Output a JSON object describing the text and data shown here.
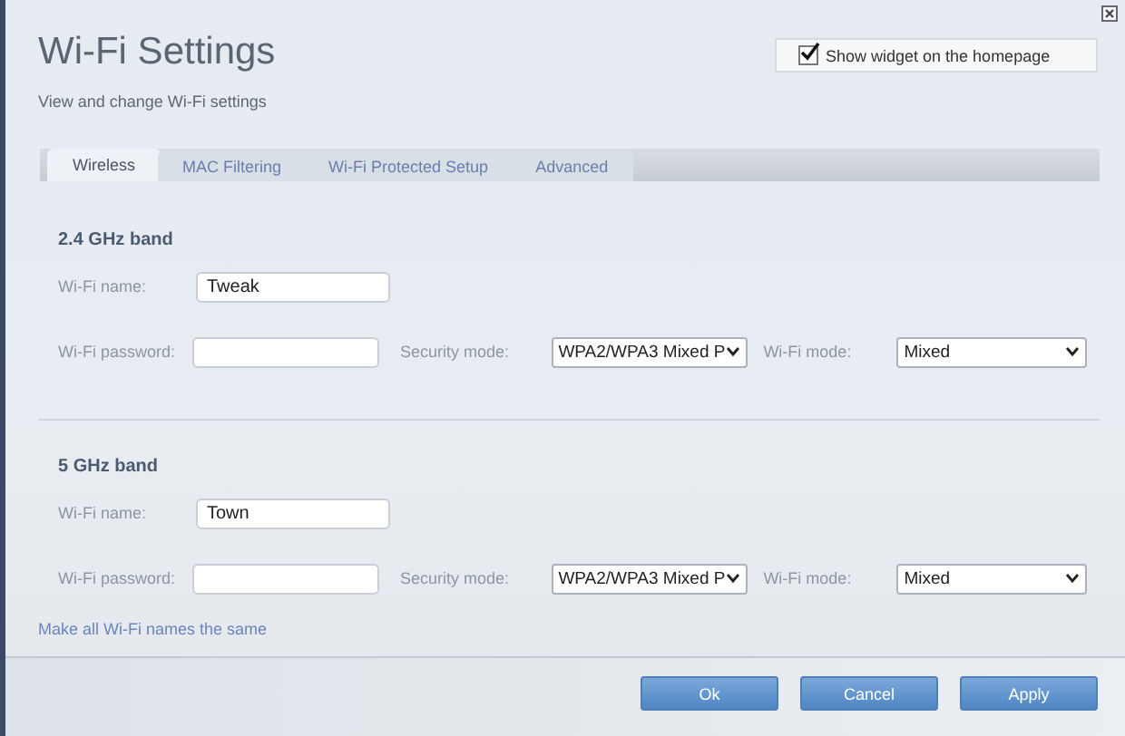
{
  "window": {
    "title": "Wi-Fi Settings",
    "subtitle": "View and change Wi-Fi settings"
  },
  "widget_option": {
    "label": "Show widget on the homepage",
    "checked": true
  },
  "tabs": [
    {
      "label": "Wireless",
      "selected": true
    },
    {
      "label": "MAC Filtering",
      "selected": false
    },
    {
      "label": "Wi-Fi Protected Setup",
      "selected": false
    },
    {
      "label": "Advanced",
      "selected": false
    }
  ],
  "bands": [
    {
      "title": "2.4 GHz band",
      "wifi_name": {
        "label": "Wi-Fi name:",
        "value": "Tweak"
      },
      "wifi_password": {
        "label": "Wi-Fi password:"
      },
      "security_mode": {
        "label": "Security mode:",
        "value": "WPA2/WPA3 Mixed P"
      },
      "wifi_mode": {
        "label": "Wi-Fi mode:",
        "value": "Mixed"
      }
    },
    {
      "title": "5 GHz band",
      "wifi_name": {
        "label": "Wi-Fi name:",
        "value": "Town"
      },
      "wifi_password": {
        "label": "Wi-Fi password:"
      },
      "security_mode": {
        "label": "Security mode:",
        "value": "WPA2/WPA3 Mixed P"
      },
      "wifi_mode": {
        "label": "Wi-Fi mode:",
        "value": "Mixed"
      }
    }
  ],
  "link": "Make all Wi-Fi names the same",
  "buttons": [
    {
      "label": "Ok"
    },
    {
      "label": "Cancel"
    },
    {
      "label": "Apply"
    }
  ]
}
